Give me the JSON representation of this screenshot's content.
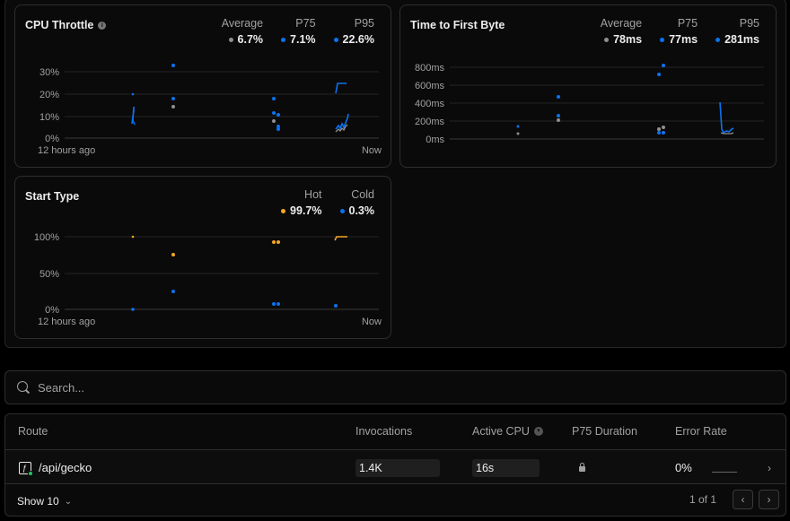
{
  "cards": {
    "cpu": {
      "title": "CPU Throttle",
      "stats": [
        {
          "label": "Average",
          "value": "6.7%",
          "color": "#8f8f8f"
        },
        {
          "label": "P75",
          "value": "7.1%",
          "color": "#0a72ef"
        },
        {
          "label": "P95",
          "value": "22.6%",
          "color": "#0a72ef"
        }
      ],
      "y_ticks": [
        "30%",
        "20%",
        "10%",
        "0%"
      ],
      "start_label": "12 hours ago",
      "end_label": "Now"
    },
    "ttfb": {
      "title": "Time to First Byte",
      "stats": [
        {
          "label": "Average",
          "value": "78ms",
          "color": "#8f8f8f"
        },
        {
          "label": "P75",
          "value": "77ms",
          "color": "#0a72ef"
        },
        {
          "label": "P95",
          "value": "281ms",
          "color": "#0a72ef"
        }
      ],
      "y_ticks": [
        "800ms",
        "600ms",
        "400ms",
        "200ms",
        "0ms"
      ]
    },
    "start": {
      "title": "Start Type",
      "stats": [
        {
          "label": "Hot",
          "value": "99.7%",
          "color": "#f5a623"
        },
        {
          "label": "Cold",
          "value": "0.3%",
          "color": "#0a72ef"
        }
      ],
      "y_ticks": [
        "100%",
        "50%",
        "0%"
      ],
      "start_label": "12 hours ago",
      "end_label": "Now"
    }
  },
  "search": {
    "placeholder": "Search..."
  },
  "table": {
    "columns": [
      "Route",
      "Invocations",
      "Active CPU",
      "P75 Duration",
      "Error Rate"
    ],
    "rows": [
      {
        "route": "/api/gecko",
        "invocations": "1.4K",
        "active_cpu": "16s",
        "error_rate": "0%"
      }
    ],
    "show_label": "Show 10",
    "page_label": "1 of 1"
  },
  "icons": {
    "search": "search-icon",
    "route": "function-icon",
    "lock": "lock-icon",
    "row_chevron": "chevron-right-icon",
    "prev": "chevron-left-icon",
    "next": "chevron-right-icon",
    "show": "chevron-down-icon",
    "sort": "sort-icon",
    "info": "info-icon"
  }
}
